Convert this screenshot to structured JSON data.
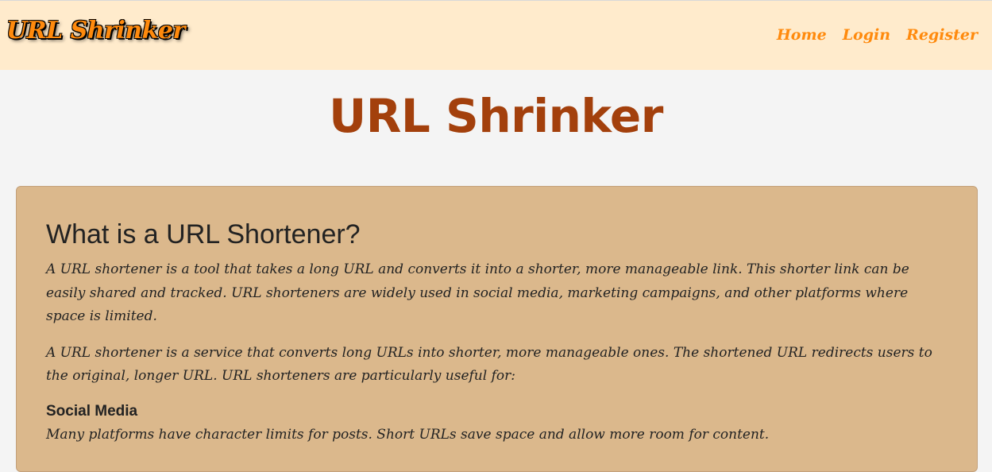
{
  "navbar": {
    "brand": "URL Shrinker",
    "links": [
      {
        "label": "Home"
      },
      {
        "label": "Login"
      },
      {
        "label": "Register"
      }
    ]
  },
  "page_title": "URL Shrinker",
  "card": {
    "heading": "What is a URL Shortener?",
    "paragraph1": "A URL shortener is a tool that takes a long URL and converts it into a shorter, more manageable link. This shorter link can be easily shared and tracked. URL shorteners are widely used in social media, marketing campaigns, and other platforms where space is limited.",
    "paragraph2": "A URL shortener is a service that converts long URLs into shorter, more manageable ones. The shortened URL redirects users to the original, longer URL. URL shorteners are particularly useful for:",
    "uses": [
      {
        "title": "Social Media",
        "description": "Many platforms have character limits for posts. Short URLs save space and allow more room for content."
      }
    ]
  },
  "colors": {
    "navbar_bg": "#ffebcc",
    "accent_orange": "#ff8a0d",
    "title_brown": "#a3400c",
    "card_bg": "#dbb88c",
    "page_bg": "#f4f4f4"
  }
}
